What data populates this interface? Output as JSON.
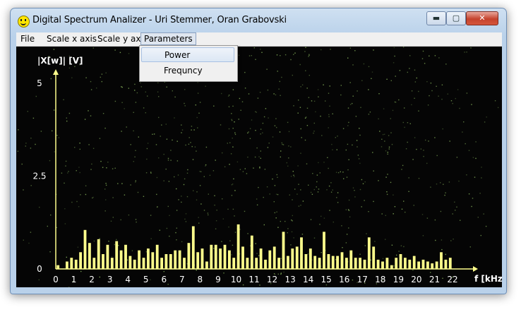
{
  "window": {
    "title": "Digital Spectrum Analizer - Uri Stemmer, Oran Grabovski",
    "min_glyph": "▬",
    "max_glyph": "▢",
    "close_glyph": "✕"
  },
  "menu": {
    "items": [
      "File",
      "Scale x axis",
      "Scale y axis",
      "Parameters"
    ],
    "open_index": 3,
    "dropdown": [
      "Power",
      "Frequncy"
    ],
    "highlighted": "Power"
  },
  "colors": {
    "axis": "#ffff8c",
    "bars": "#ffff8c",
    "background": "#050505",
    "noise": "#9ccf6a"
  },
  "chart_data": {
    "type": "bar",
    "ylabel": "|X[w]| [V]",
    "xlabel": "f [kHz]",
    "ylim": [
      0,
      5
    ],
    "yticks": [
      "5",
      "2.5",
      "0"
    ],
    "xlim": [
      0,
      22
    ],
    "xticks": [
      "0",
      "1",
      "2",
      "3",
      "4",
      "5",
      "6",
      "7",
      "8",
      "9",
      "10",
      "11",
      "12",
      "13",
      "14",
      "15",
      "16",
      "17",
      "18",
      "19",
      "20",
      "21",
      "22"
    ],
    "x_step": 0.25,
    "values": [
      0.1,
      0,
      0.2,
      0.3,
      0.25,
      0.45,
      1.05,
      0.7,
      0.3,
      0.8,
      0.4,
      0.65,
      0.3,
      0.75,
      0.5,
      0.65,
      0.35,
      0.25,
      0.5,
      0.3,
      0.55,
      0.45,
      0.65,
      0.3,
      0.4,
      0.4,
      0.5,
      0.5,
      0.3,
      0.7,
      1.15,
      0.45,
      0.55,
      0.2,
      0.65,
      0.65,
      0.55,
      0.65,
      0.5,
      0.3,
      1.2,
      0.6,
      0.3,
      0.9,
      0.3,
      0.55,
      0.25,
      0.5,
      0.6,
      0.3,
      1.0,
      0.35,
      0.55,
      0.6,
      0.85,
      0.4,
      0.55,
      0.35,
      0.3,
      1.0,
      0.4,
      0.35,
      0.35,
      0.45,
      0.3,
      0.5,
      0.3,
      0.3,
      0.25,
      0.85,
      0.6,
      0.25,
      0.2,
      0.3,
      0.1,
      0.3,
      0.4,
      0.3,
      0.25,
      0.35,
      0.2,
      0.25,
      0.2,
      0.15,
      0.2,
      0.45,
      0.25,
      0.3,
      0.2,
      0.2,
      0.3,
      0.2,
      0.15,
      0.2,
      0.3,
      0.2,
      0.2,
      0.15,
      0.3,
      0.25,
      0.15,
      0.2,
      0.15,
      0.1,
      0.3,
      0.15,
      0.2,
      0.15,
      0.1,
      0.2,
      0.1,
      0.15,
      0.1,
      0.1,
      0.1,
      0.1,
      0.05,
      0.1,
      0.1,
      0.05,
      0.05,
      0.05,
      0.05,
      0.05,
      0.05,
      0.05,
      0.05,
      0.05,
      0.05,
      0.05,
      0.05,
      0.05,
      0.05,
      0.05,
      0.05,
      0.05,
      0.05,
      0.05,
      0.05,
      0.05,
      0.05,
      0.05,
      0.05,
      0.05,
      0.05,
      0.05,
      0.05,
      0.05,
      0.05,
      0.05,
      0.05,
      0.05,
      0.05,
      0.05,
      0.05,
      0.05,
      0.05,
      0.05,
      0.05,
      0.05,
      0.05,
      0.05,
      0.05,
      0.05,
      0.05,
      0.05,
      0.05,
      0.05,
      0.05,
      0.05,
      0.05,
      0.05,
      0.05,
      0.05,
      0.05,
      0.05,
      0.05,
      0.05,
      0.05,
      0.05,
      0.05,
      0.05,
      0.05,
      0.05,
      0.05,
      0.05,
      0.05,
      0.05,
      0.05,
      0.05,
      0.05,
      0.05,
      0.05,
      0.05,
      0.05,
      0.05,
      0.05,
      0.05,
      0.05,
      0.05,
      0.05,
      0.05,
      0.05,
      0.05,
      0.05,
      0.05,
      0.05,
      0.05,
      0.05,
      0.05,
      0.05,
      0.05,
      0.05,
      0.05,
      0.05,
      0.05,
      0.05,
      0.05,
      0.05,
      0.05,
      0.05
    ]
  }
}
